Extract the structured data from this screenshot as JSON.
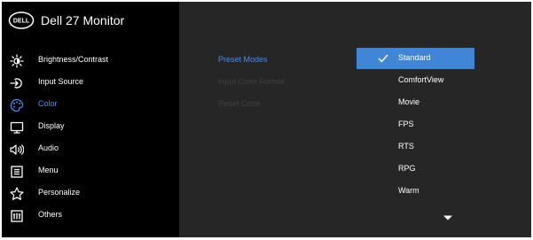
{
  "app": {
    "title": "Dell 27 Monitor",
    "logo_text": "DELL"
  },
  "sidebar": {
    "items": [
      {
        "label": "Brightness/Contrast",
        "icon": "brightness-icon"
      },
      {
        "label": "Input Source",
        "icon": "input-source-icon"
      },
      {
        "label": "Color",
        "icon": "color-palette-icon",
        "active": true
      },
      {
        "label": "Display",
        "icon": "display-icon"
      },
      {
        "label": "Audio",
        "icon": "speaker-icon"
      },
      {
        "label": "Menu",
        "icon": "menu-icon"
      },
      {
        "label": "Personalize",
        "icon": "star-icon"
      },
      {
        "label": "Others",
        "icon": "others-icon"
      }
    ]
  },
  "submenu": {
    "items": [
      {
        "label": "Preset Modes",
        "enabled": true
      },
      {
        "label": "Input Color Format",
        "enabled": false
      },
      {
        "label": "Reset Color",
        "enabled": false
      }
    ]
  },
  "options": {
    "items": [
      {
        "label": "Standard",
        "selected": true
      },
      {
        "label": "ComfortView"
      },
      {
        "label": "Movie"
      },
      {
        "label": "FPS"
      },
      {
        "label": "RTS"
      },
      {
        "label": "RPG"
      },
      {
        "label": "Warm"
      }
    ],
    "more_icon": "caret-down-icon"
  },
  "colors": {
    "panel": "#262626",
    "sidebar": "#000000",
    "accent": "#3c8ff5",
    "selected_bg": "#3f87d6",
    "disabled_text": "#3f3f3f",
    "text": "#ffffff"
  }
}
